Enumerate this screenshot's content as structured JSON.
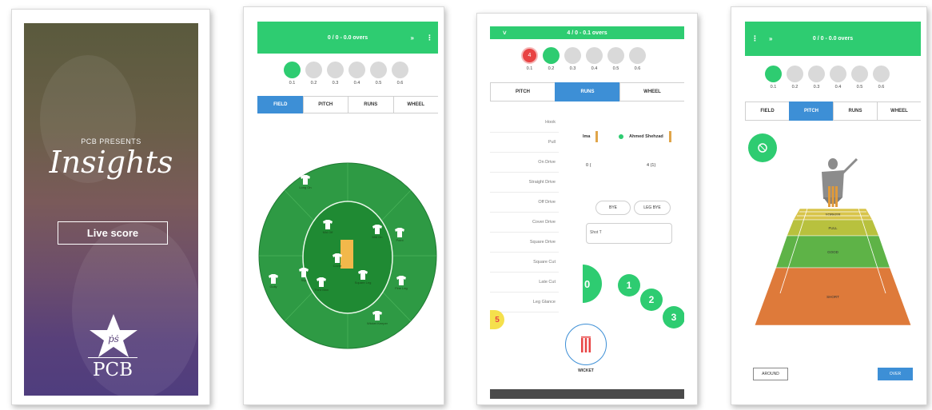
{
  "splash": {
    "presents": "PCB PRESENTS",
    "title": "Insights",
    "live_button": "Live score",
    "logo_text": "PCB"
  },
  "field_screen": {
    "header": "0 / 0 - 0.0 overs",
    "chevron": "»",
    "menu": "⋮",
    "balls": [
      {
        "label": "0.1",
        "current": true
      },
      {
        "label": "0.2"
      },
      {
        "label": "0.3"
      },
      {
        "label": "0.4"
      },
      {
        "label": "0.5"
      },
      {
        "label": "0.6"
      }
    ],
    "tabs": [
      {
        "label": "FIELD",
        "active": true
      },
      {
        "label": "PITCH"
      },
      {
        "label": "RUNS"
      },
      {
        "label": "WHEEL"
      }
    ],
    "players": [
      {
        "label": "Long On"
      },
      {
        "label": "Mid Off"
      },
      {
        "label": "Mid On"
      },
      {
        "label": "Point"
      },
      {
        "label": "Cover"
      },
      {
        "label": "Slip"
      },
      {
        "label": "Gully"
      },
      {
        "label": "Fine Leg"
      },
      {
        "label": "Third Man"
      },
      {
        "label": "Square Leg"
      },
      {
        "label": "Wicket Keeper"
      }
    ]
  },
  "runs_screen": {
    "header": "4 / 0 - 0.1 overs",
    "chevron": "˅",
    "balls": [
      {
        "label": "0.1",
        "value": "4",
        "red": true
      },
      {
        "label": "0.2",
        "current": true
      },
      {
        "label": "0.3"
      },
      {
        "label": "0.4"
      },
      {
        "label": "0.5"
      },
      {
        "label": "0.6"
      }
    ],
    "tabs": [
      {
        "label": "PITCH"
      },
      {
        "label": "RUNS",
        "active": true
      },
      {
        "label": "WHEEL"
      }
    ],
    "shots": [
      "Hook",
      "Pull",
      "On Drive",
      "Straight Drive",
      "Off Drive",
      "Cover Drive",
      "Square Drive",
      "Square Cut",
      "Late Cut",
      "Leg Glance"
    ],
    "batsman_name": "Ahmed Shehzad",
    "batsman_score": "4 (1)",
    "other_score": "0 (",
    "other_name": "Ima",
    "extras": [
      "LEG BYE",
      "BYE"
    ],
    "shot_field": "Shot T",
    "runs": [
      "1",
      "2",
      "3"
    ],
    "partial_run": "5",
    "partial_zero": "0",
    "wicket_label": "WICKET"
  },
  "pitch_screen": {
    "header": "0 / 0 - 0.0 overs",
    "chevron": "»",
    "menu": "⋮",
    "balls": [
      {
        "label": "0.1",
        "current": true
      },
      {
        "label": "0.2"
      },
      {
        "label": "0.3"
      },
      {
        "label": "0.4"
      },
      {
        "label": "0.5"
      },
      {
        "label": "0.6"
      }
    ],
    "tabs": [
      {
        "label": "FIELD"
      },
      {
        "label": "PITCH",
        "active": true
      },
      {
        "label": "RUNS"
      },
      {
        "label": "WHEEL"
      }
    ],
    "zones": [
      "YORKER",
      "FULL",
      "GOOD",
      "SHORT"
    ],
    "buttons": {
      "around": "AROUND",
      "over": "OVER"
    }
  },
  "colors": {
    "accent_green": "#2ecc71",
    "tab_blue": "#3d8fd6",
    "wicket_red": "#e84343",
    "field_green": "#2e9a44"
  }
}
